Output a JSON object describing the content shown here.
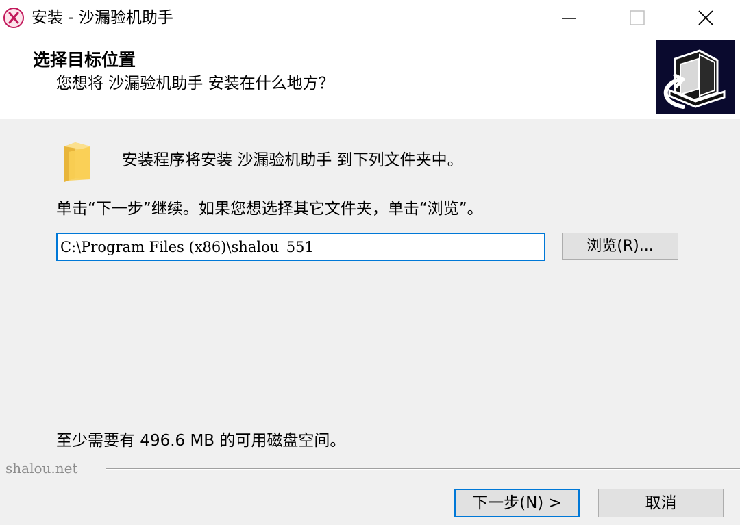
{
  "window": {
    "title": "安装 - 沙漏验机助手",
    "icon": "app-logo-icon",
    "controls": [
      "minimize-icon",
      "maximize-icon",
      "close-icon"
    ]
  },
  "header": {
    "title": "选择目标位置",
    "subtitle": "您想将 沙漏验机助手 安装在什么地方？",
    "image": "installer-computer-image"
  },
  "main": {
    "intro": "安装程序将安装 沙漏验机助手 到下列文件夹中。",
    "instruction": "单击“下一步”继续。如果您想选择其它文件夹，单击“浏览”。",
    "path_value": "C:\\Program Files (x86)\\shalou_551",
    "browse_label": "浏览(R)...",
    "disk_space": "至少需要有 496.6 MB 的可用磁盘空间。"
  },
  "footer": {
    "branding": "shalou.net",
    "next_label": "下一步(N) >",
    "cancel_label": "取消"
  },
  "colors": {
    "accent": "#0078d7",
    "background": "#f0f0f0",
    "button": "#e1e1e1",
    "logo": "#c2185b"
  }
}
